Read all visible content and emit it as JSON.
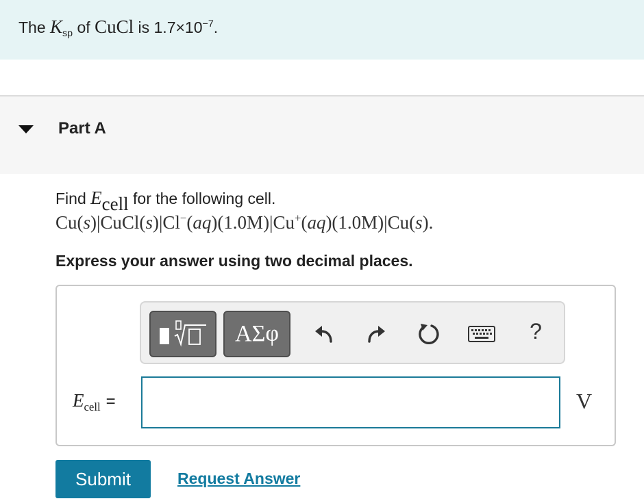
{
  "intro": {
    "prefix": "The",
    "ksp_symbol": "K",
    "ksp_subscript": "sp",
    "of": "of",
    "compound": "CuCl",
    "is": "is",
    "value_mantissa": "1.7×10",
    "value_exponent": "−7",
    "period": "."
  },
  "part": {
    "title": "Part A"
  },
  "question": {
    "find": "Find",
    "e_symbol": "E",
    "e_subscript": "cell",
    "rest": "for the following cell.",
    "reaction_1": "Cu(",
    "reaction_s1": "s",
    "reaction_2": ")|CuCl(",
    "reaction_s2": "s",
    "reaction_3": ")|Cl",
    "reaction_sup1": "−",
    "reaction_4": "(",
    "reaction_aq1": "aq",
    "reaction_5": ")(1.0M)|Cu",
    "reaction_sup2": "+",
    "reaction_6": "(",
    "reaction_aq2": "aq",
    "reaction_7": ")(1.0M)|Cu(",
    "reaction_s3": "s",
    "reaction_8": ")."
  },
  "instruction": "Express your answer using two decimal places.",
  "toolbar": {
    "greek_label": "ΑΣφ",
    "help_label": "?",
    "icons": [
      "templates-icon",
      "greek-letters-icon",
      "undo-icon",
      "redo-icon",
      "reset-icon",
      "keyboard-icon",
      "help-icon"
    ]
  },
  "answer": {
    "lhs_symbol": "E",
    "lhs_subscript": "cell",
    "equals": "=",
    "value": "",
    "unit": "V"
  },
  "actions": {
    "submit": "Submit",
    "request_answer": "Request Answer"
  },
  "colors": {
    "intro_bg": "#e6f4f5",
    "accent": "#127ba0",
    "input_border": "#1a7a98",
    "toolbar_button": "#6f6f6f"
  }
}
